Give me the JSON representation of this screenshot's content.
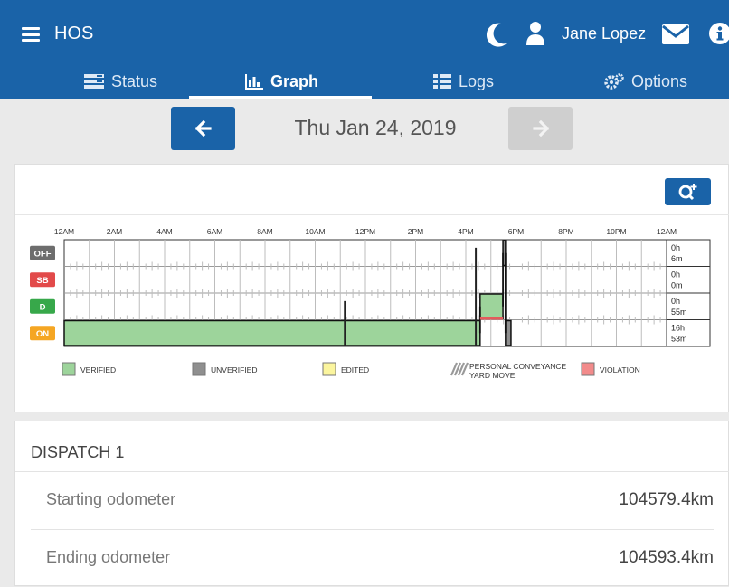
{
  "app": {
    "title": "HOS",
    "user_name": "Jane Lopez"
  },
  "icons": {
    "menu": "hamburger-icon",
    "night_mode": "moon-icon",
    "user": "user-icon",
    "messages": "mail-icon",
    "info": "info-icon",
    "prev": "arrow-left-icon",
    "next": "arrow-right-icon",
    "zoom": "zoom-in-icon"
  },
  "tabs": [
    {
      "label": "Status",
      "icon": "status-icon",
      "active": false
    },
    {
      "label": "Graph",
      "icon": "bar-chart-icon",
      "active": true
    },
    {
      "label": "Logs",
      "icon": "list-icon",
      "active": false
    },
    {
      "label": "Options",
      "icon": "gears-icon",
      "active": false
    }
  ],
  "date_nav": {
    "date": "Thu Jan 24, 2019",
    "next_enabled": false
  },
  "chart_data": {
    "type": "hos-log-grid",
    "x_tick_labels": [
      "12AM",
      "2AM",
      "4AM",
      "6AM",
      "8AM",
      "10AM",
      "12PM",
      "2PM",
      "4PM",
      "6PM",
      "8PM",
      "10PM",
      "12AM"
    ],
    "statuses": [
      {
        "key": "off",
        "label": "OFF",
        "color": "#6d6d6d",
        "total": [
          "0h",
          "6m"
        ]
      },
      {
        "key": "sb",
        "label": "SB",
        "color": "#e24a4a",
        "total": [
          "0h",
          "0m"
        ]
      },
      {
        "key": "d",
        "label": "D",
        "color": "#37a84a",
        "total": [
          "0h",
          "55m"
        ]
      },
      {
        "key": "on",
        "label": "ON",
        "color": "#f5a623",
        "total": [
          "16h",
          "53m"
        ]
      }
    ],
    "segments": [
      {
        "status": "on",
        "start_hour": 0.0,
        "end_hour": 16.57,
        "kind": "verified"
      },
      {
        "status": "d",
        "start_hour": 16.57,
        "end_hour": 17.48,
        "kind": "verified"
      },
      {
        "status": "d",
        "start_hour": 16.57,
        "end_hour": 17.48,
        "kind": "violation"
      },
      {
        "status": "off",
        "start_hour": 17.48,
        "end_hour": 17.58,
        "kind": "unverified"
      },
      {
        "status": "on",
        "start_hour": 17.58,
        "end_hour": 17.8,
        "kind": "unverified"
      }
    ],
    "legend": [
      {
        "key": "verified",
        "label": "VERIFIED",
        "color": "#9dd49b"
      },
      {
        "key": "unverified",
        "label": "UNVERIFIED",
        "color": "#8f8f8f"
      },
      {
        "key": "edited",
        "label": "EDITED",
        "color": "#fbf59e"
      },
      {
        "key": "personal",
        "label": "PERSONAL CONVEYANCE",
        "label2": "YARD MOVE",
        "color": "#999999"
      },
      {
        "key": "violation",
        "label": "VIOLATION",
        "color": "#f28b8b"
      }
    ]
  },
  "dispatch": {
    "title": "DISPATCH 1",
    "rows": [
      {
        "label": "Starting odometer",
        "value": "104579.4km"
      },
      {
        "label": "Ending odometer",
        "value": "104593.4km"
      }
    ]
  }
}
